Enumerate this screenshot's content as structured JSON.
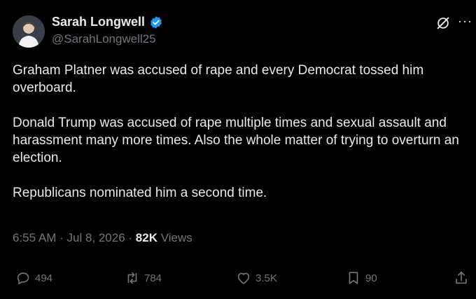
{
  "author": {
    "name": "Sarah Longwell",
    "handle": "@SarahLongwell25",
    "verified": true,
    "accent": "#1d9bf0"
  },
  "tweet": {
    "paragraphs": [
      "Graham Platner was accused of rape and every Democrat tossed him overboard.",
      "Donald Trump was accused of rape multiple times and sexual assault and harassment many more times. Also the whole matter of trying to overturn an election.",
      "Republicans nominated him a second time."
    ],
    "time": "6:55 AM",
    "date": "Jul 8, 2026",
    "views_count": "82K",
    "views_label": "Views"
  },
  "actions": {
    "replies": "494",
    "reposts": "784",
    "likes": "3.5K",
    "bookmarks": "90"
  },
  "icons": [
    "verified-badge-icon",
    "grok-icon",
    "more-icon",
    "reply-icon",
    "repost-icon",
    "like-icon",
    "bookmark-icon",
    "share-icon"
  ]
}
